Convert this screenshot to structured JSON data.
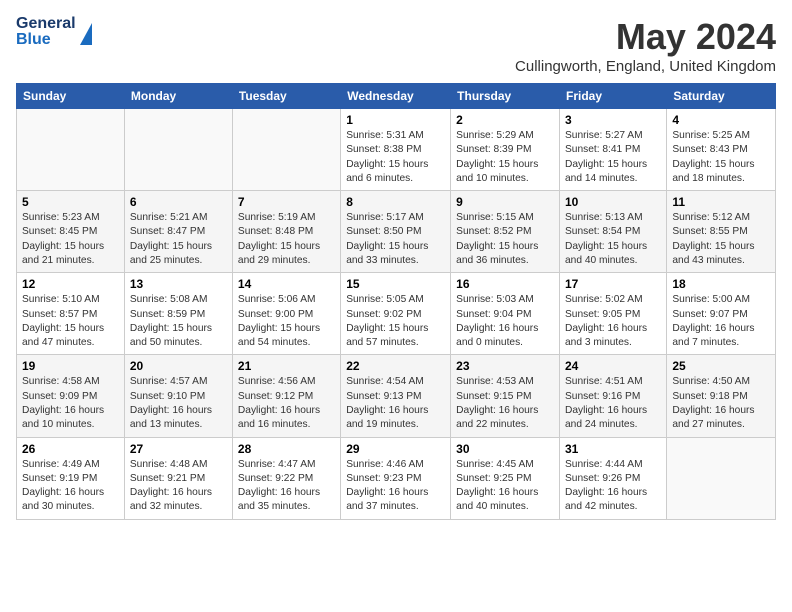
{
  "header": {
    "logo_general": "General",
    "logo_blue": "Blue",
    "month_title": "May 2024",
    "subtitle": "Cullingworth, England, United Kingdom"
  },
  "weekdays": [
    "Sunday",
    "Monday",
    "Tuesday",
    "Wednesday",
    "Thursday",
    "Friday",
    "Saturday"
  ],
  "weeks": [
    [
      {
        "day": "",
        "info": ""
      },
      {
        "day": "",
        "info": ""
      },
      {
        "day": "",
        "info": ""
      },
      {
        "day": "1",
        "info": "Sunrise: 5:31 AM\nSunset: 8:38 PM\nDaylight: 15 hours\nand 6 minutes."
      },
      {
        "day": "2",
        "info": "Sunrise: 5:29 AM\nSunset: 8:39 PM\nDaylight: 15 hours\nand 10 minutes."
      },
      {
        "day": "3",
        "info": "Sunrise: 5:27 AM\nSunset: 8:41 PM\nDaylight: 15 hours\nand 14 minutes."
      },
      {
        "day": "4",
        "info": "Sunrise: 5:25 AM\nSunset: 8:43 PM\nDaylight: 15 hours\nand 18 minutes."
      }
    ],
    [
      {
        "day": "5",
        "info": "Sunrise: 5:23 AM\nSunset: 8:45 PM\nDaylight: 15 hours\nand 21 minutes."
      },
      {
        "day": "6",
        "info": "Sunrise: 5:21 AM\nSunset: 8:47 PM\nDaylight: 15 hours\nand 25 minutes."
      },
      {
        "day": "7",
        "info": "Sunrise: 5:19 AM\nSunset: 8:48 PM\nDaylight: 15 hours\nand 29 minutes."
      },
      {
        "day": "8",
        "info": "Sunrise: 5:17 AM\nSunset: 8:50 PM\nDaylight: 15 hours\nand 33 minutes."
      },
      {
        "day": "9",
        "info": "Sunrise: 5:15 AM\nSunset: 8:52 PM\nDaylight: 15 hours\nand 36 minutes."
      },
      {
        "day": "10",
        "info": "Sunrise: 5:13 AM\nSunset: 8:54 PM\nDaylight: 15 hours\nand 40 minutes."
      },
      {
        "day": "11",
        "info": "Sunrise: 5:12 AM\nSunset: 8:55 PM\nDaylight: 15 hours\nand 43 minutes."
      }
    ],
    [
      {
        "day": "12",
        "info": "Sunrise: 5:10 AM\nSunset: 8:57 PM\nDaylight: 15 hours\nand 47 minutes."
      },
      {
        "day": "13",
        "info": "Sunrise: 5:08 AM\nSunset: 8:59 PM\nDaylight: 15 hours\nand 50 minutes."
      },
      {
        "day": "14",
        "info": "Sunrise: 5:06 AM\nSunset: 9:00 PM\nDaylight: 15 hours\nand 54 minutes."
      },
      {
        "day": "15",
        "info": "Sunrise: 5:05 AM\nSunset: 9:02 PM\nDaylight: 15 hours\nand 57 minutes."
      },
      {
        "day": "16",
        "info": "Sunrise: 5:03 AM\nSunset: 9:04 PM\nDaylight: 16 hours\nand 0 minutes."
      },
      {
        "day": "17",
        "info": "Sunrise: 5:02 AM\nSunset: 9:05 PM\nDaylight: 16 hours\nand 3 minutes."
      },
      {
        "day": "18",
        "info": "Sunrise: 5:00 AM\nSunset: 9:07 PM\nDaylight: 16 hours\nand 7 minutes."
      }
    ],
    [
      {
        "day": "19",
        "info": "Sunrise: 4:58 AM\nSunset: 9:09 PM\nDaylight: 16 hours\nand 10 minutes."
      },
      {
        "day": "20",
        "info": "Sunrise: 4:57 AM\nSunset: 9:10 PM\nDaylight: 16 hours\nand 13 minutes."
      },
      {
        "day": "21",
        "info": "Sunrise: 4:56 AM\nSunset: 9:12 PM\nDaylight: 16 hours\nand 16 minutes."
      },
      {
        "day": "22",
        "info": "Sunrise: 4:54 AM\nSunset: 9:13 PM\nDaylight: 16 hours\nand 19 minutes."
      },
      {
        "day": "23",
        "info": "Sunrise: 4:53 AM\nSunset: 9:15 PM\nDaylight: 16 hours\nand 22 minutes."
      },
      {
        "day": "24",
        "info": "Sunrise: 4:51 AM\nSunset: 9:16 PM\nDaylight: 16 hours\nand 24 minutes."
      },
      {
        "day": "25",
        "info": "Sunrise: 4:50 AM\nSunset: 9:18 PM\nDaylight: 16 hours\nand 27 minutes."
      }
    ],
    [
      {
        "day": "26",
        "info": "Sunrise: 4:49 AM\nSunset: 9:19 PM\nDaylight: 16 hours\nand 30 minutes."
      },
      {
        "day": "27",
        "info": "Sunrise: 4:48 AM\nSunset: 9:21 PM\nDaylight: 16 hours\nand 32 minutes."
      },
      {
        "day": "28",
        "info": "Sunrise: 4:47 AM\nSunset: 9:22 PM\nDaylight: 16 hours\nand 35 minutes."
      },
      {
        "day": "29",
        "info": "Sunrise: 4:46 AM\nSunset: 9:23 PM\nDaylight: 16 hours\nand 37 minutes."
      },
      {
        "day": "30",
        "info": "Sunrise: 4:45 AM\nSunset: 9:25 PM\nDaylight: 16 hours\nand 40 minutes."
      },
      {
        "day": "31",
        "info": "Sunrise: 4:44 AM\nSunset: 9:26 PM\nDaylight: 16 hours\nand 42 minutes."
      },
      {
        "day": "",
        "info": ""
      }
    ]
  ]
}
